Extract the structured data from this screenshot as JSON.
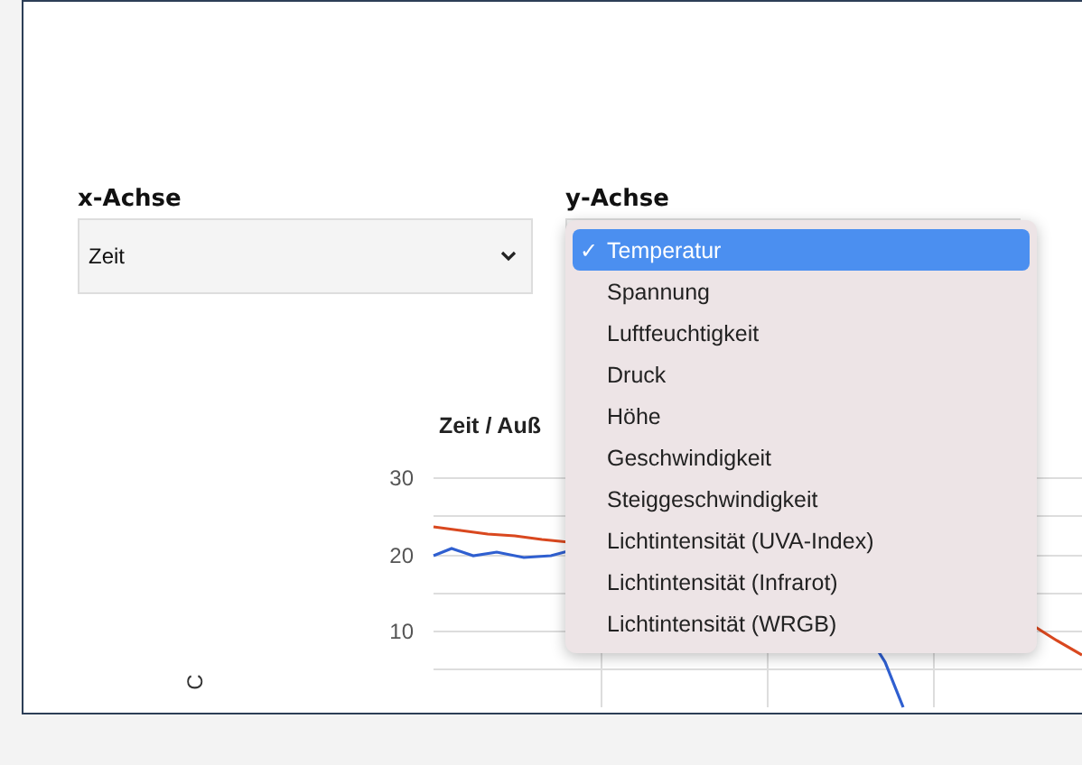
{
  "x_axis": {
    "label": "x-Achse",
    "value": "Zeit"
  },
  "y_axis": {
    "label": "y-Achse",
    "check_mark": "✓",
    "options": [
      {
        "label": "Temperatur",
        "selected": true
      },
      {
        "label": "Spannung",
        "selected": false
      },
      {
        "label": "Luftfeuchtigkeit",
        "selected": false
      },
      {
        "label": "Druck",
        "selected": false
      },
      {
        "label": "Höhe",
        "selected": false
      },
      {
        "label": "Geschwindigkeit",
        "selected": false
      },
      {
        "label": "Steiggeschwindigkeit",
        "selected": false
      },
      {
        "label": "Lichtintensität (UVA-Index)",
        "selected": false
      },
      {
        "label": "Lichtintensität (Infrarot)",
        "selected": false
      },
      {
        "label": "Lichtintensität (WRGB)",
        "selected": false
      }
    ]
  },
  "chart": {
    "title": "Zeit / Auß",
    "y_ticks": [
      "30",
      "20",
      "10"
    ],
    "y_label": "C"
  }
}
